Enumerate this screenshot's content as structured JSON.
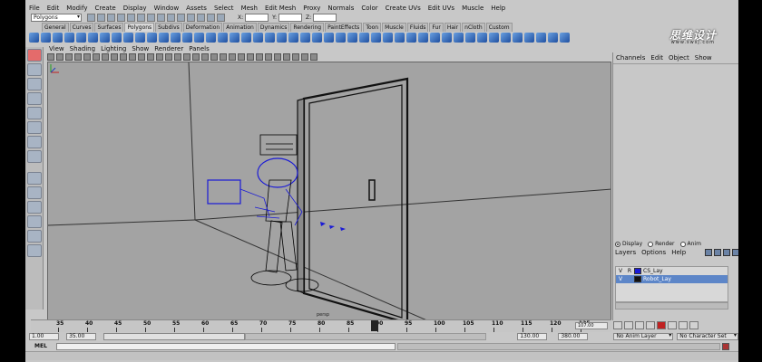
{
  "menu": [
    "File",
    "Edit",
    "Modify",
    "Create",
    "Display",
    "Window",
    "Assets",
    "Select",
    "Mesh",
    "Edit Mesh",
    "Proxy",
    "Normals",
    "Color",
    "Create UVs",
    "Edit UVs",
    "Muscle",
    "Help"
  ],
  "status_line": {
    "mode": "Polygons",
    "field_x": "X:",
    "field_y": "Y:",
    "field_z": "Z:"
  },
  "shelf_tabs": [
    "General",
    "Curves",
    "Surfaces",
    "Polygons",
    "Subdivs",
    "Deformation",
    "Animation",
    "Dynamics",
    "Rendering",
    "PaintEffects",
    "Toon",
    "Muscle",
    "Fluids",
    "Fur",
    "Hair",
    "nCloth",
    "Custom"
  ],
  "active_shelf_tab": "Polygons",
  "watermark": {
    "title": "思维设计",
    "sub": "www.swsj.com"
  },
  "panel_menu": [
    "View",
    "Shading",
    "Lighting",
    "Show",
    "Renderer",
    "Panels"
  ],
  "viewport": {
    "camera_label": "persp"
  },
  "channel_box": {
    "menu": [
      "Channels",
      "Edit",
      "Object",
      "Show"
    ]
  },
  "layer_editor": {
    "modes": [
      {
        "label": "Display",
        "selected": true
      },
      {
        "label": "Render",
        "selected": false
      },
      {
        "label": "Anim",
        "selected": false
      }
    ],
    "menu": [
      "Layers",
      "Options",
      "Help"
    ],
    "layers": [
      {
        "visible": "V",
        "ref": "R",
        "name": "CS_Lay",
        "color": "#1a1ad6",
        "selected": false
      },
      {
        "visible": "V",
        "ref": "",
        "name": "Robot_Lay",
        "color": "#111111",
        "selected": true
      }
    ]
  },
  "time_slider": {
    "ticks": [
      "35",
      "40",
      "45",
      "50",
      "55",
      "60",
      "65",
      "70",
      "75",
      "80",
      "85",
      "90",
      "95",
      "100",
      "105",
      "110",
      "115",
      "120",
      "125"
    ],
    "current_frame": "107.00"
  },
  "range_slider": {
    "start_time": "1.00",
    "playback_start": "35.00",
    "playback_end": "130.00",
    "end_time": "380.00",
    "anim_layer": "No Anim Layer",
    "character_set": "No Character Set"
  },
  "command_line": {
    "label": "MEL"
  }
}
